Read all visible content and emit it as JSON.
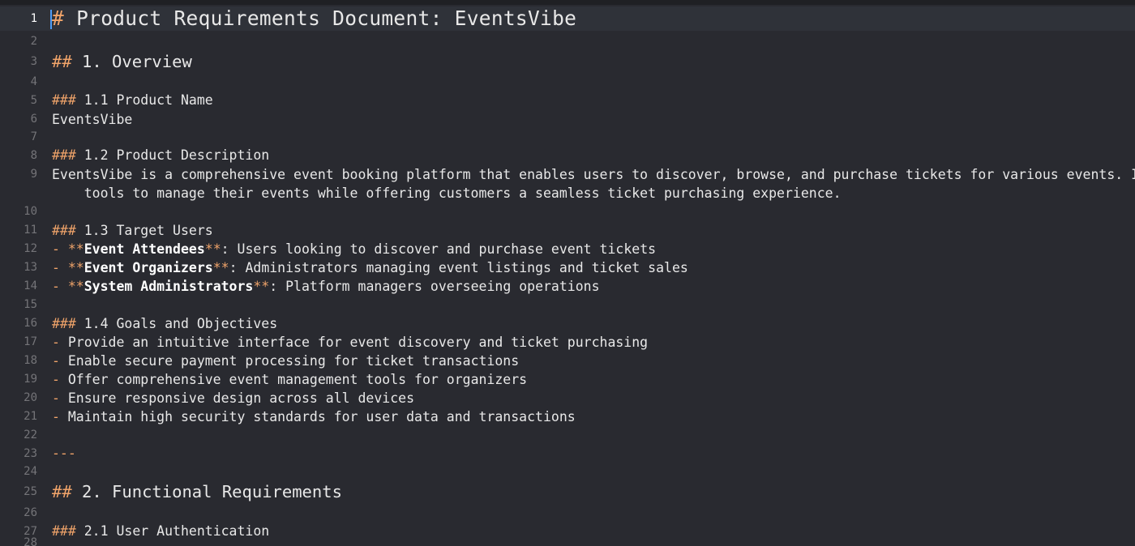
{
  "editor": {
    "current_line": 1,
    "lines": [
      {
        "n": "1",
        "segments": [
          {
            "t": "# ",
            "c": "mk"
          },
          {
            "t": "Product Requirements Document: EventsVibe"
          }
        ]
      },
      {
        "n": "2",
        "segments": []
      },
      {
        "n": "3",
        "segments": [
          {
            "t": "## ",
            "c": "mk"
          },
          {
            "t": "1. Overview"
          }
        ]
      },
      {
        "n": "4",
        "segments": []
      },
      {
        "n": "5",
        "segments": [
          {
            "t": "### ",
            "c": "mk"
          },
          {
            "t": "1.1 Product Name"
          }
        ]
      },
      {
        "n": "6",
        "segments": [
          {
            "t": "EventsVibe"
          }
        ]
      },
      {
        "n": "7",
        "segments": []
      },
      {
        "n": "8",
        "segments": [
          {
            "t": "### ",
            "c": "mk"
          },
          {
            "t": "1.2 Product Description"
          }
        ]
      },
      {
        "n": "9",
        "segments": [
          {
            "t": "EventsVibe is a comprehensive event booking platform that enables users to discover, browse, and purchase tickets for various events. It"
          }
        ]
      },
      {
        "n": "",
        "segments": [
          {
            "t": "    tools to manage their events while offering customers a seamless ticket purchasing experience."
          }
        ]
      },
      {
        "n": "10",
        "segments": []
      },
      {
        "n": "11",
        "segments": [
          {
            "t": "### ",
            "c": "mk"
          },
          {
            "t": "1.3 Target Users"
          }
        ]
      },
      {
        "n": "12",
        "segments": [
          {
            "t": "- ",
            "c": "mk"
          },
          {
            "t": "**",
            "c": "mk"
          },
          {
            "t": "Event Attendees",
            "c": "b"
          },
          {
            "t": "**",
            "c": "mk"
          },
          {
            "t": ": Users looking to discover and purchase event tickets"
          }
        ]
      },
      {
        "n": "13",
        "segments": [
          {
            "t": "- ",
            "c": "mk"
          },
          {
            "t": "**",
            "c": "mk"
          },
          {
            "t": "Event Organizers",
            "c": "b"
          },
          {
            "t": "**",
            "c": "mk"
          },
          {
            "t": ": Administrators managing event listings and ticket sales"
          }
        ]
      },
      {
        "n": "14",
        "segments": [
          {
            "t": "- ",
            "c": "mk"
          },
          {
            "t": "**",
            "c": "mk"
          },
          {
            "t": "System Administrators",
            "c": "b"
          },
          {
            "t": "**",
            "c": "mk"
          },
          {
            "t": ": Platform managers overseeing operations"
          }
        ]
      },
      {
        "n": "15",
        "segments": []
      },
      {
        "n": "16",
        "segments": [
          {
            "t": "### ",
            "c": "mk"
          },
          {
            "t": "1.4 Goals and Objectives"
          }
        ]
      },
      {
        "n": "17",
        "segments": [
          {
            "t": "- ",
            "c": "mk"
          },
          {
            "t": "Provide an intuitive interface for event discovery and ticket purchasing"
          }
        ]
      },
      {
        "n": "18",
        "segments": [
          {
            "t": "- ",
            "c": "mk"
          },
          {
            "t": "Enable secure payment processing for ticket transactions"
          }
        ]
      },
      {
        "n": "19",
        "segments": [
          {
            "t": "- ",
            "c": "mk"
          },
          {
            "t": "Offer comprehensive event management tools for organizers"
          }
        ]
      },
      {
        "n": "20",
        "segments": [
          {
            "t": "- ",
            "c": "mk"
          },
          {
            "t": "Ensure responsive design across all devices"
          }
        ]
      },
      {
        "n": "21",
        "segments": [
          {
            "t": "- ",
            "c": "mk"
          },
          {
            "t": "Maintain high security standards for user data and transactions"
          }
        ]
      },
      {
        "n": "22",
        "segments": []
      },
      {
        "n": "23",
        "segments": [
          {
            "t": "---",
            "c": "mk"
          }
        ]
      },
      {
        "n": "24",
        "segments": []
      },
      {
        "n": "25",
        "segments": [
          {
            "t": "## ",
            "c": "mk"
          },
          {
            "t": "2. Functional Requirements"
          }
        ]
      },
      {
        "n": "26",
        "segments": []
      },
      {
        "n": "27",
        "segments": [
          {
            "t": "### ",
            "c": "mk"
          },
          {
            "t": "2.1 User Authentication"
          }
        ]
      },
      {
        "n": "28",
        "segments": []
      }
    ]
  }
}
